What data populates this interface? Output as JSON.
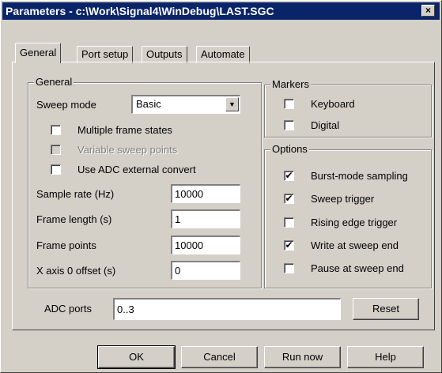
{
  "window": {
    "title": "Parameters - c:\\Work\\Signal4\\WinDebug\\LAST.SGC",
    "close_glyph": "×"
  },
  "tabs": [
    "General",
    "Port setup",
    "Outputs",
    "Automate"
  ],
  "general": {
    "group_label": "General",
    "sweep_mode_label": "Sweep mode",
    "sweep_mode_value": "Basic",
    "checkboxes": [
      {
        "label": "Multiple frame states",
        "checked": false,
        "enabled": true
      },
      {
        "label": "Variable sweep points",
        "checked": false,
        "enabled": false
      },
      {
        "label": "Use ADC external convert",
        "checked": false,
        "enabled": true
      }
    ],
    "fields": [
      {
        "label": "Sample rate (Hz)",
        "value": "10000"
      },
      {
        "label": "Frame length (s)",
        "value": "1"
      },
      {
        "label": "Frame points",
        "value": "10000"
      },
      {
        "label": "X axis 0 offset (s)",
        "value": "0"
      }
    ]
  },
  "markers": {
    "group_label": "Markers",
    "items": [
      {
        "label": "Keyboard",
        "checked": false
      },
      {
        "label": "Digital",
        "checked": false
      }
    ]
  },
  "options": {
    "group_label": "Options",
    "items": [
      {
        "label": "Burst-mode sampling",
        "checked": true
      },
      {
        "label": "Sweep trigger",
        "checked": true
      },
      {
        "label": "Rising edge trigger",
        "checked": false
      },
      {
        "label": "Write at sweep end",
        "checked": true
      },
      {
        "label": "Pause at sweep end",
        "checked": false
      }
    ]
  },
  "adc": {
    "label": "ADC ports",
    "value": "0..3",
    "reset_label": "Reset"
  },
  "buttons": {
    "ok": "OK",
    "cancel": "Cancel",
    "run_now": "Run now",
    "help": "Help"
  },
  "check_glyph": "✔"
}
